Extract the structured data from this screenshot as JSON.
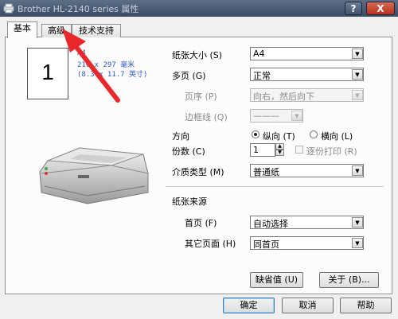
{
  "window": {
    "title": "Brother HL-2140 series 属性",
    "help_btn": "?",
    "close_btn": "X"
  },
  "tabs": [
    {
      "label": "基本",
      "active": true
    },
    {
      "label": "高级",
      "active": false
    },
    {
      "label": "技术支持",
      "active": false
    }
  ],
  "preview": {
    "page_number": "1",
    "paper_size_line1": "A4",
    "paper_size_line2": "210 x 297 毫米",
    "paper_size_line3": "(8.3 x 11.7 英寸)"
  },
  "fields": {
    "paper_size": {
      "label": "纸张大小 (S)",
      "value": "A4"
    },
    "multi_page": {
      "label": "多页 (G)",
      "value": "正常"
    },
    "page_order": {
      "label": "页序 (P)",
      "value": "向右，然后向下"
    },
    "border_line": {
      "label": "边框线 (Q)",
      "value": "———"
    },
    "orientation": {
      "label": "方向",
      "portrait": "纵向 (T)",
      "landscape": "横向 (L)",
      "selected": "portrait"
    },
    "copies": {
      "label": "份数 (C)",
      "value": "1",
      "collate_label": "逐份打印 (R)"
    },
    "media_type": {
      "label": "介质类型 (M)",
      "value": "普通纸"
    },
    "paper_source": {
      "label": "纸张来源"
    },
    "first_page": {
      "label": "首页 (F)",
      "value": "自动选择"
    },
    "other_pages": {
      "label": "其它页面 (H)",
      "value": "同首页"
    }
  },
  "panel_buttons": {
    "default": "缺省值 (U)",
    "about": "关于 (B)..."
  },
  "dialog_buttons": {
    "ok": "确定",
    "cancel": "取消",
    "help": "帮助"
  },
  "colors": {
    "titlebar": "#3a4a62",
    "accent_arrow": "#e8282a",
    "paper_text": "#2d55c8"
  }
}
